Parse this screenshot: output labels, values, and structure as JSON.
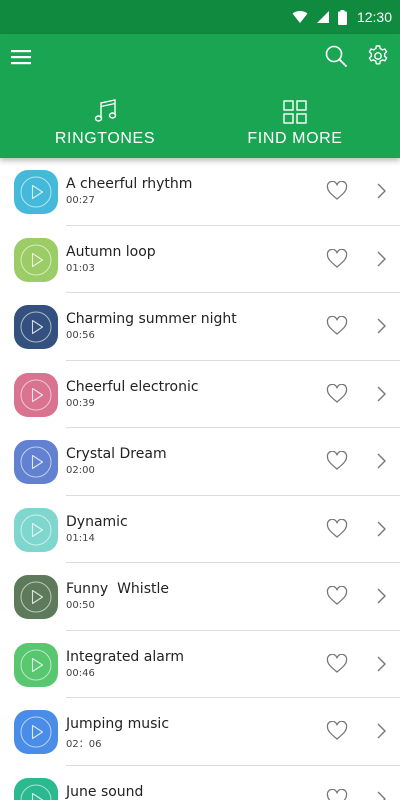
{
  "status_bar": {
    "time": "12:30",
    "icons": [
      "wifi-icon",
      "signal-icon",
      "battery-icon"
    ]
  },
  "toolbar": {
    "icons": [
      "menu-icon",
      "search-icon",
      "gear-icon"
    ]
  },
  "tabs": [
    {
      "label": "RINGTONES",
      "icon": "music-note-icon"
    },
    {
      "label": "FIND MORE",
      "icon": "grid-icon"
    }
  ],
  "colors": {
    "status_bar": "#108a3e",
    "app_bar": "#1aa553"
  },
  "ringtones": [
    {
      "title": "A cheerful rhythm",
      "duration": "00:27",
      "color": "#45b9d9"
    },
    {
      "title": "Autumn loop",
      "duration": "01:03",
      "color": "#9ccc65"
    },
    {
      "title": "Charming summer night",
      "duration": "00:56",
      "color": "#34507e"
    },
    {
      "title": "Cheerful electronic",
      "duration": "00:39",
      "color": "#d97390"
    },
    {
      "title": "Crystal Dream",
      "duration": "02:00",
      "color": "#6282d1"
    },
    {
      "title": "Dynamic",
      "duration": "01:14",
      "color": "#7fd6cd"
    },
    {
      "title": "Funny  Whistle",
      "duration": "00:50",
      "color": "#5d7a5b"
    },
    {
      "title": "Integrated alarm",
      "duration": "00:46",
      "color": "#58c770"
    },
    {
      "title": "Jumping music",
      "duration": "02：06",
      "color": "#4a8de8"
    },
    {
      "title": "June sound",
      "duration": "",
      "color": "#2bb98f"
    }
  ]
}
